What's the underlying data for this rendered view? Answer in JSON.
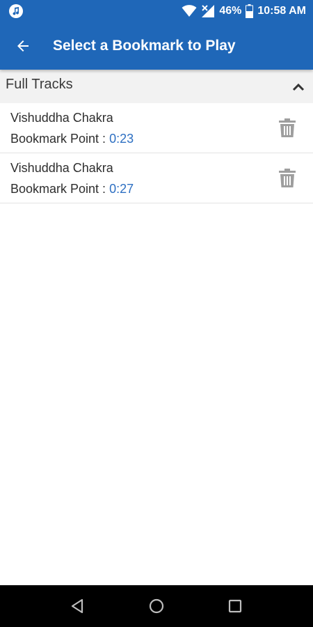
{
  "status_bar": {
    "battery": "46%",
    "time": "10:58 AM",
    "left_icon": "music-note-icon",
    "icons": [
      "wifi-icon",
      "signal-icon",
      "battery-icon"
    ]
  },
  "app_bar": {
    "title": "Select a Bookmark to Play",
    "back_icon": "arrow-left-icon",
    "color": "#1f67b8"
  },
  "section": {
    "title": "Full Tracks",
    "toggle_icon": "chevron-up-icon"
  },
  "bookmarks": [
    {
      "title": "Vishuddha Chakra",
      "point_label": "Bookmark Point : ",
      "time": "0:23",
      "action_icon": "trash-icon"
    },
    {
      "title": "Vishuddha Chakra",
      "point_label": "Bookmark Point : ",
      "time": "0:27",
      "action_icon": "trash-icon"
    }
  ],
  "nav_bar": {
    "buttons": [
      "back-triangle-icon",
      "home-circle-icon",
      "recents-square-icon"
    ]
  },
  "colors": {
    "accent": "#1f67b8",
    "time_text": "#2d6fc2",
    "section_bg": "#f2f2f2",
    "icon_gray": "#9e9e9e"
  }
}
